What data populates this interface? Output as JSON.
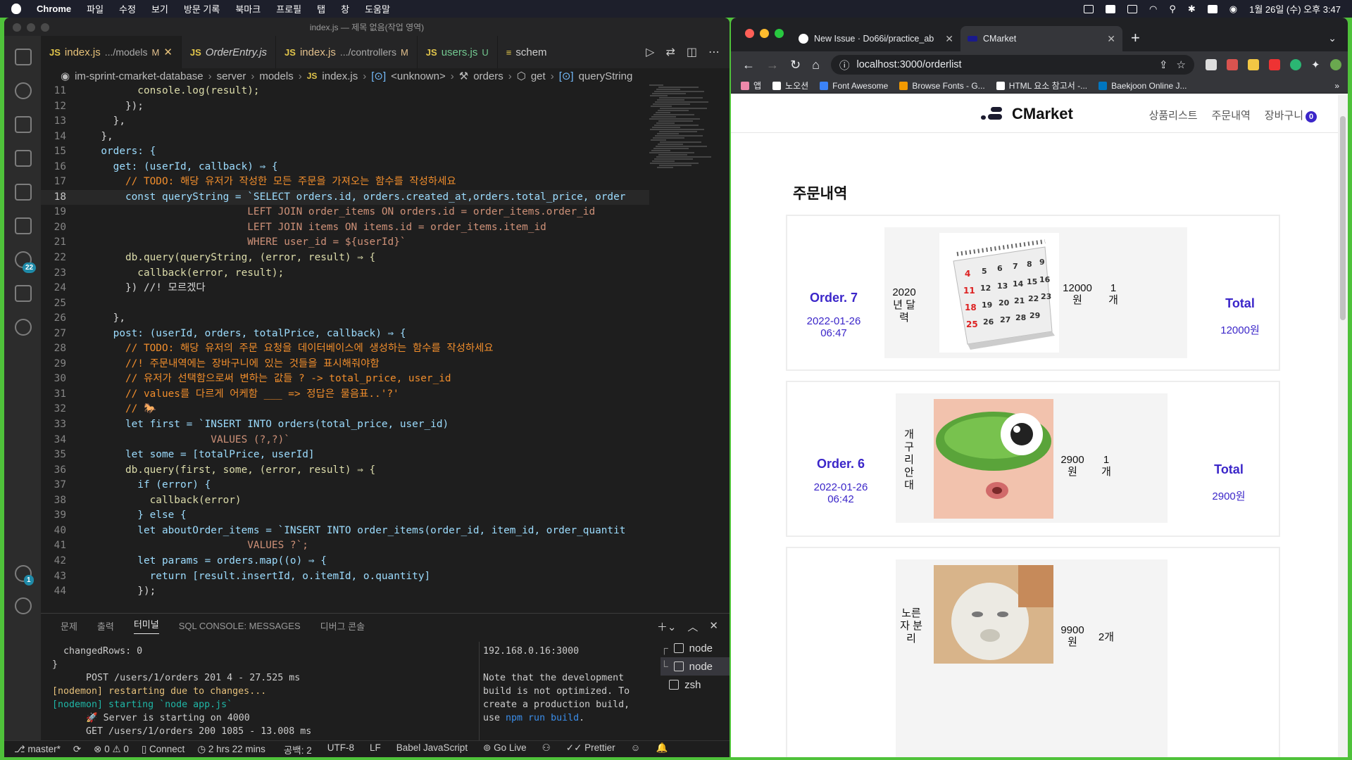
{
  "menubar": {
    "app": "Chrome",
    "items": [
      "파일",
      "수정",
      "보기",
      "방문 기록",
      "북마크",
      "프로필",
      "탭",
      "창",
      "도움말"
    ],
    "clock": "1월 26일 (수) 오후 3:47"
  },
  "vscode": {
    "window_title": "index.js — 제목 없음(작업 영역)",
    "tabs": [
      {
        "name": "index.js",
        "path": ".../models",
        "flag": "M"
      },
      {
        "name": "OrderEntry.js",
        "path": "",
        "flag": ""
      },
      {
        "name": "index.js",
        "path": ".../controllers",
        "flag": "M"
      },
      {
        "name": "users.js",
        "path": "",
        "flag": "U"
      },
      {
        "name": "schem",
        "path": "",
        "flag": ""
      }
    ],
    "breadcrumb": [
      "im-sprint-cmarket-database",
      "server",
      "models",
      "index.js",
      "<unknown>",
      "orders",
      "get",
      "queryString"
    ],
    "source_control_badge": "22",
    "accounts_badge": "1",
    "code_lines": [
      {
        "n": "11",
        "t": "        console.log(result);"
      },
      {
        "n": "12",
        "t": "      });"
      },
      {
        "n": "13",
        "t": "    },"
      },
      {
        "n": "14",
        "t": "  },"
      },
      {
        "n": "15",
        "t": "  orders: {"
      },
      {
        "n": "16",
        "t": "    get: (userId, callback) ⇒ {"
      },
      {
        "n": "17",
        "t": "      // TODO: 해당 유저가 작성한 모든 주문을 가져오는 함수를 작성하세요"
      },
      {
        "n": "18",
        "t": "      const queryString = `SELECT orders.id, orders.created_at,orders.total_price, order"
      },
      {
        "n": "19",
        "t": "                          LEFT JOIN order_items ON orders.id = order_items.order_id"
      },
      {
        "n": "20",
        "t": "                          LEFT JOIN items ON items.id = order_items.item_id"
      },
      {
        "n": "21",
        "t": "                          WHERE user_id = ${userId}`"
      },
      {
        "n": "22",
        "t": "      db.query(queryString, (error, result) ⇒ {"
      },
      {
        "n": "23",
        "t": "        callback(error, result);"
      },
      {
        "n": "24",
        "t": "      }) //! 모르겠다"
      },
      {
        "n": "25",
        "t": ""
      },
      {
        "n": "26",
        "t": "    },"
      },
      {
        "n": "27",
        "t": "    post: (userId, orders, totalPrice, callback) ⇒ {"
      },
      {
        "n": "28",
        "t": "      // TODO: 해당 유저의 주문 요청을 데이터베이스에 생성하는 함수를 작성하세요"
      },
      {
        "n": "29",
        "t": "      //! 주문내역에는 장바구니에 있는 것들을 표시해줘야함"
      },
      {
        "n": "30",
        "t": "      // 유저가 선택함으로써 변하는 값들 ? -> total_price, user_id"
      },
      {
        "n": "31",
        "t": "      // values를 다르게 어케함 ___ => 정답은 물음표..'?'"
      },
      {
        "n": "32",
        "t": "      // 🐎"
      },
      {
        "n": "33",
        "t": "      let first = `INSERT INTO orders(total_price, user_id)"
      },
      {
        "n": "34",
        "t": "                    VALUES (?,?)`"
      },
      {
        "n": "35",
        "t": "      let some = [totalPrice, userId]"
      },
      {
        "n": "36",
        "t": "      db.query(first, some, (error, result) ⇒ {"
      },
      {
        "n": "37",
        "t": "        if (error) {"
      },
      {
        "n": "38",
        "t": "          callback(error)"
      },
      {
        "n": "39",
        "t": "        } else {"
      },
      {
        "n": "40",
        "t": "        let aboutOrder_items = `INSERT INTO order_items(order_id, item_id, order_quantit"
      },
      {
        "n": "41",
        "t": "                          VALUES ?`;"
      },
      {
        "n": "42",
        "t": "        let params = orders.map((o) ⇒ {"
      },
      {
        "n": "43",
        "t": "          return [result.insertId, o.itemId, o.quantity]"
      },
      {
        "n": "44",
        "t": "        });"
      }
    ],
    "panel_tabs": [
      "문제",
      "출력",
      "터미널",
      "SQL CONSOLE: MESSAGES",
      "디버그 콘솔"
    ],
    "terminal_left": [
      "  changedRows: 0",
      "}",
      "      POST /users/1/orders 201 4 - 27.525 ms",
      "[nodemon] restarting due to changes...",
      "[nodemon] starting `node app.js`",
      "      🚀 Server is starting on 4000",
      "      GET /users/1/orders 200 1085 - 13.008 ms",
      "▯"
    ],
    "terminal_right": {
      "addr": "192.168.0.16:3000",
      "msg": "Note that the development build is not optimized. To create a production build, use ",
      "cmd": "npm run build",
      "end": "."
    },
    "terminal_list": [
      "node",
      "node",
      "zsh"
    ],
    "status": {
      "branch": "master*",
      "problems": "⊗ 0 ⚠ 0",
      "connect": "Connect",
      "time": "2 hrs 22 mins",
      "spaces": "공백: 2",
      "encoding": "UTF-8",
      "eol": "LF",
      "lang": "Babel JavaScript",
      "golive": "Go Live",
      "prettier": "Prettier"
    }
  },
  "browser": {
    "tabs": [
      {
        "title": "New Issue · Do66i/practice_ab"
      },
      {
        "title": "CMarket"
      }
    ],
    "url": "localhost:3000/orderlist",
    "bookmarks": [
      "앱",
      "노오션",
      "Font Awesome",
      "Browse Fonts - G...",
      "HTML 요소 참고서 -...",
      "Baekjoon Online J..."
    ]
  },
  "site": {
    "logo": "CMarket",
    "nav": [
      "상품리스트",
      "주문내역",
      "장바구니"
    ],
    "cart_count": "0",
    "page_title": "주문내역",
    "orders": [
      {
        "num": "Order. 7",
        "date": "2022-01-26 06:47",
        "item": "2020년 달력",
        "price": "12000원",
        "qty": "1개",
        "total_label": "Total",
        "total": "12000원"
      },
      {
        "num": "Order. 6",
        "date": "2022-01-26 06:42",
        "item": "개구리 안대",
        "price": "2900원",
        "qty": "1개",
        "total_label": "Total",
        "total": "2900원"
      },
      {
        "num": "",
        "date": "",
        "item": "노른자 분리",
        "price": "9900원",
        "qty": "2개",
        "total_label": "",
        "total": ""
      }
    ]
  }
}
